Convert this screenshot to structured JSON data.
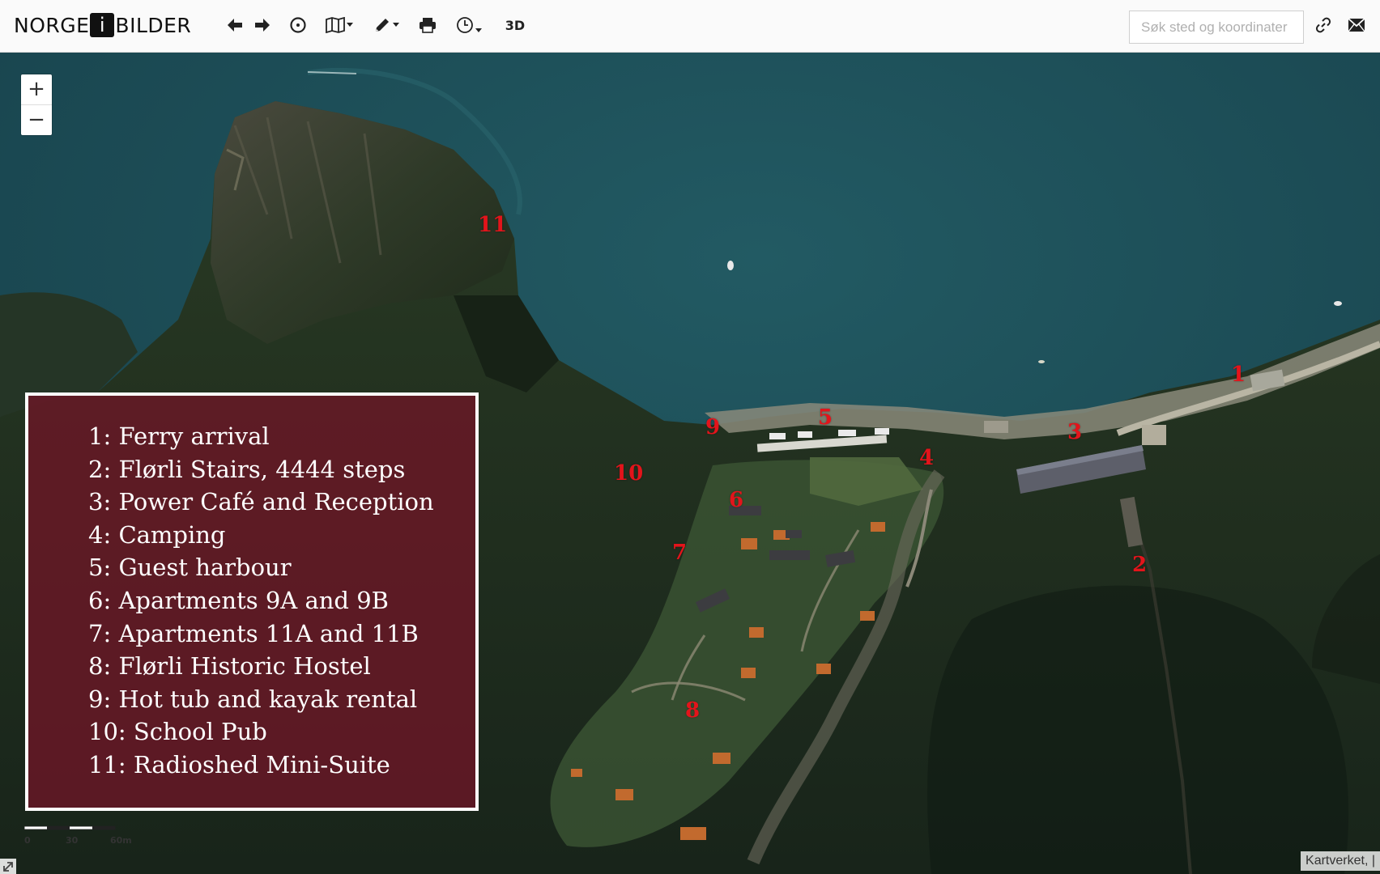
{
  "header": {
    "logo": {
      "prefix": "NORGE",
      "middle": "i",
      "suffix": "BILDER"
    },
    "tools": [
      {
        "name": "back",
        "icon": "arrow-left-icon"
      },
      {
        "name": "forward",
        "icon": "arrow-right-icon"
      },
      {
        "name": "reset-view",
        "icon": "circle-icon"
      },
      {
        "name": "map-layers",
        "icon": "map-icon"
      },
      {
        "name": "draw",
        "icon": "pencil-icon"
      },
      {
        "name": "print",
        "icon": "printer-icon"
      },
      {
        "name": "history",
        "icon": "clock-icon"
      },
      {
        "name": "three-d",
        "label": "3D"
      }
    ],
    "search": {
      "placeholder": "Søk sted og koordinater",
      "value": ""
    },
    "share_icon": "link-icon",
    "mail_icon": "envelope-icon"
  },
  "map": {
    "zoom": {
      "in_label": "+",
      "out_label": "−"
    },
    "markers": [
      "1",
      "2",
      "3",
      "4",
      "5",
      "6",
      "7",
      "8",
      "9",
      "10",
      "11"
    ],
    "legend": [
      "1: Ferry arrival",
      "2: Flørli Stairs, 4444 steps",
      "3: Power Café and Reception",
      "4: Camping",
      "5: Guest harbour",
      "6: Apartments 9A and 9B",
      "7: Apartments 11A and 11B",
      "8: Flørli Historic Hostel",
      "9: Hot tub and kayak rental",
      "10: School Pub",
      "11: Radioshed Mini-Suite"
    ],
    "scale": {
      "labels": [
        "0",
        "30",
        "60m"
      ]
    },
    "attribution": "Kartverket, |",
    "colors": {
      "water": "#1e4d56",
      "forest": "#1f2f1c",
      "legend_bg": "#6e1626",
      "marker": "#e3141b"
    }
  }
}
